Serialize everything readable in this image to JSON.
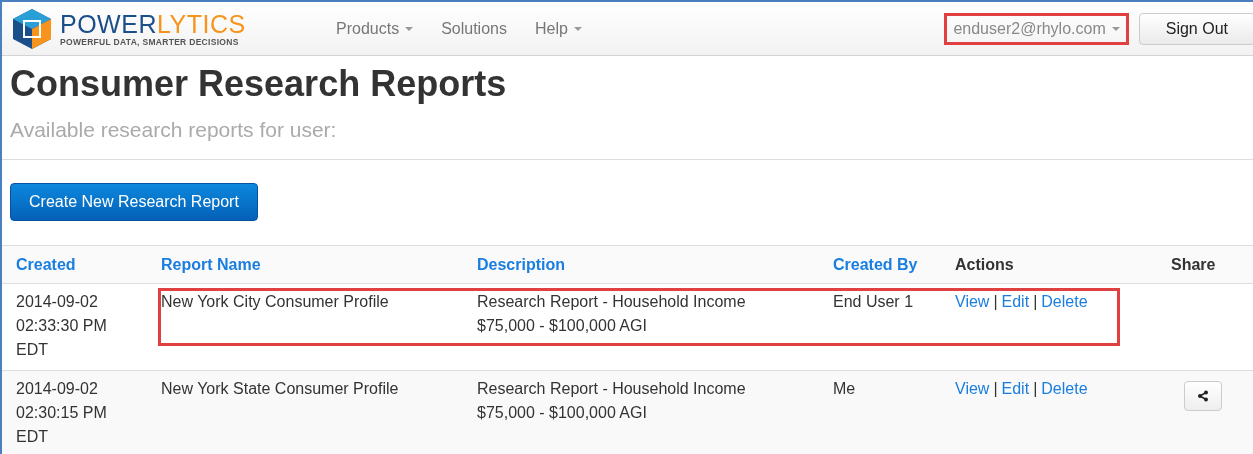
{
  "navbar": {
    "brand": {
      "name_dark": "POWER",
      "name_accent": "LYTICS",
      "tagline": "POWERFUL DATA, SMARTER DECISIONS"
    },
    "menu": [
      {
        "label": "Products",
        "dropdown": true
      },
      {
        "label": "Solutions",
        "dropdown": false
      },
      {
        "label": "Help",
        "dropdown": true
      }
    ],
    "user": {
      "label": "enduser2@rhylo.com",
      "highlighted": true
    },
    "sign_out": "Sign Out"
  },
  "page": {
    "title": "Consumer Research Reports",
    "subtitle": "Available research reports for user:",
    "create_button": "Create New Research Report"
  },
  "table": {
    "columns": [
      {
        "label": "Created",
        "sortable": true
      },
      {
        "label": "Report Name",
        "sortable": true
      },
      {
        "label": "Description",
        "sortable": true
      },
      {
        "label": "Created By",
        "sortable": true
      },
      {
        "label": "Actions",
        "sortable": false
      },
      {
        "label": "Share",
        "sortable": false
      }
    ],
    "rows": [
      {
        "created": [
          "2014-09-02",
          "02:33:30 PM",
          "EDT"
        ],
        "name": "New York City Consumer Profile",
        "description": [
          "Research Report - Household Income",
          "$75,000 - $100,000 AGI"
        ],
        "created_by": "End User 1",
        "actions": [
          "View",
          "Edit",
          "Delete"
        ],
        "separator": "|",
        "share": false,
        "highlighted": true
      },
      {
        "created": [
          "2014-09-02",
          "02:30:15 PM",
          "EDT"
        ],
        "name": "New York State Consumer Profile",
        "description": [
          "Research Report - Household Income",
          "$75,000 - $100,000 AGI"
        ],
        "created_by": "Me",
        "actions": [
          "View",
          "Edit",
          "Delete"
        ],
        "separator": "|",
        "share": true,
        "highlighted": false
      }
    ]
  }
}
